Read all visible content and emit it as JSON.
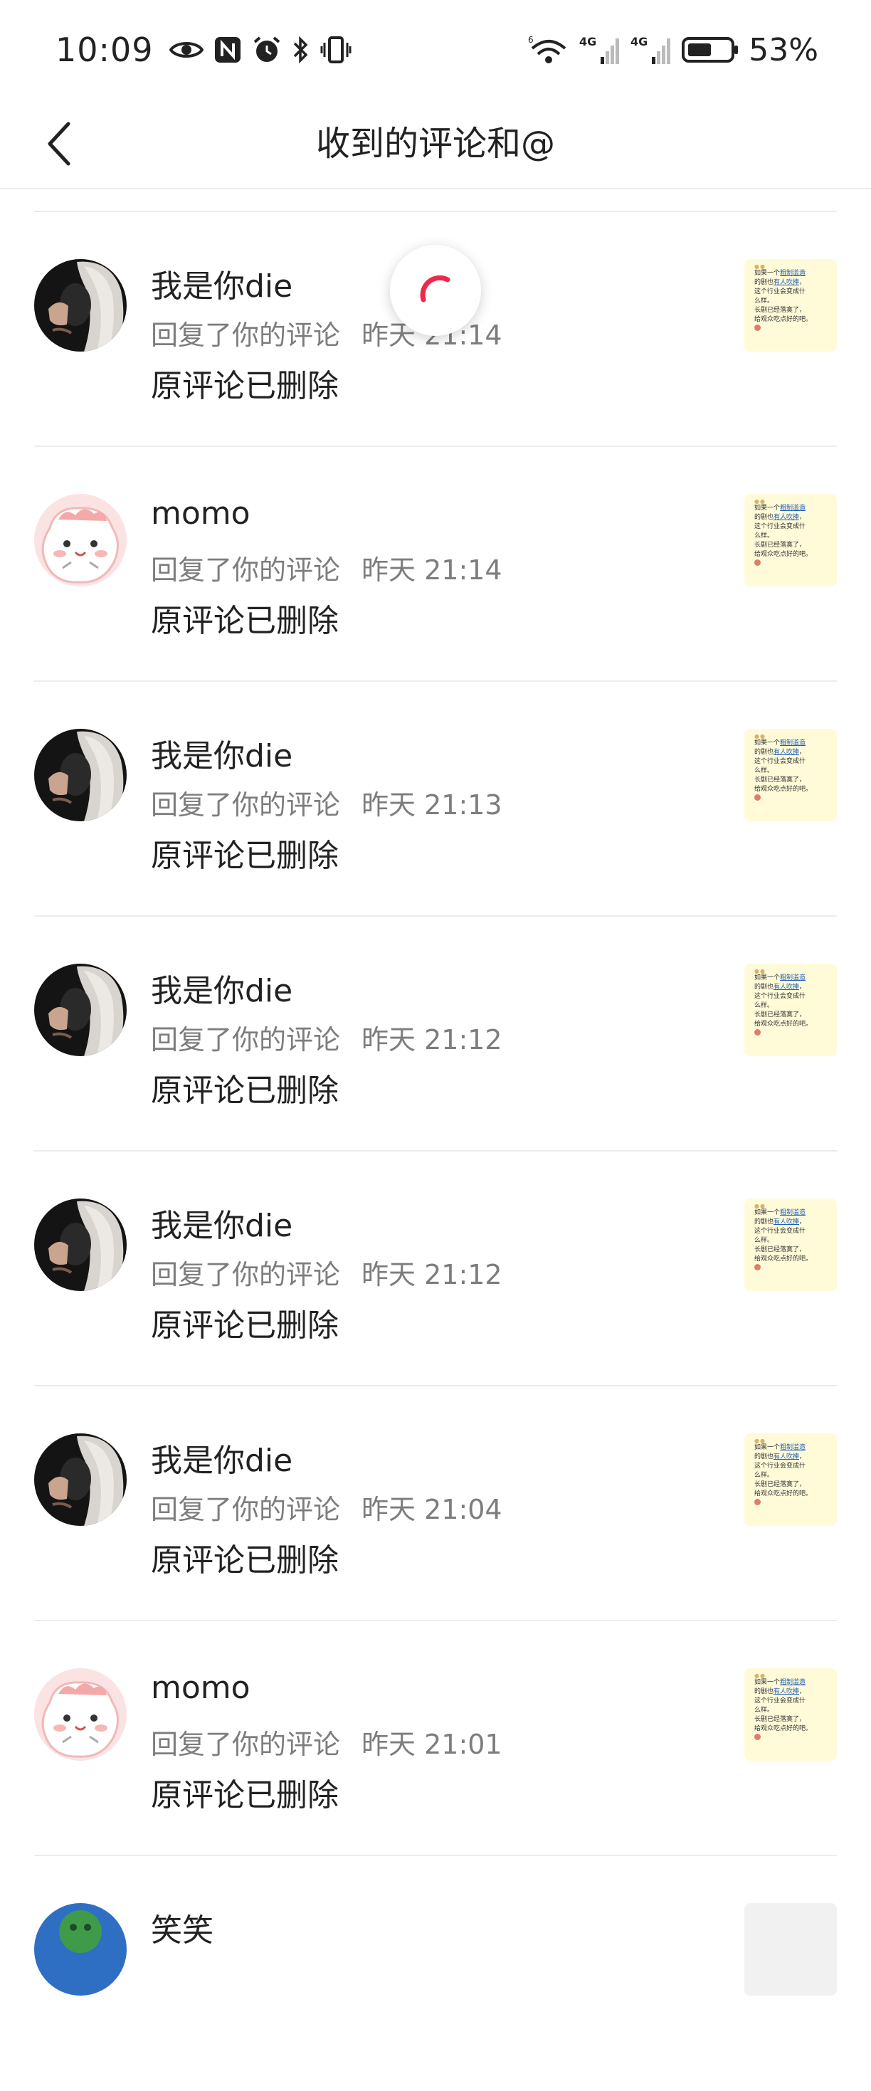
{
  "status_bar": {
    "time": "10:09",
    "battery": "53%",
    "network_1": "4G",
    "network_2": "4G",
    "wifi_badge": "6"
  },
  "header": {
    "title": "收到的评论和@"
  },
  "items": [
    {
      "name": "我是你die",
      "action": "回复了你的评论",
      "time": "昨天 21:14",
      "content": "原评论已删除",
      "avatar": "dark"
    },
    {
      "name": "momo",
      "action": "回复了你的评论",
      "time": "昨天 21:14",
      "content": "原评论已删除",
      "avatar": "pink"
    },
    {
      "name": "我是你die",
      "action": "回复了你的评论",
      "time": "昨天 21:13",
      "content": "原评论已删除",
      "avatar": "dark"
    },
    {
      "name": "我是你die",
      "action": "回复了你的评论",
      "time": "昨天 21:12",
      "content": "原评论已删除",
      "avatar": "dark"
    },
    {
      "name": "我是你die",
      "action": "回复了你的评论",
      "time": "昨天 21:12",
      "content": "原评论已删除",
      "avatar": "dark"
    },
    {
      "name": "我是你die",
      "action": "回复了你的评论",
      "time": "昨天 21:04",
      "content": "原评论已删除",
      "avatar": "dark"
    },
    {
      "name": "momo",
      "action": "回复了你的评论",
      "time": "昨天 21:01",
      "content": "原评论已删除",
      "avatar": "pink"
    },
    {
      "name": "笑笑",
      "avatar": "green"
    }
  ],
  "thumbnail": {
    "lines": [
      "如果一个",
      "粗制滥造",
      "的剧也",
      "有人吹捧",
      "，",
      "这个行业会变成什",
      "么样。",
      "长剧已经落寞了，",
      "给观众吃点好的吧。"
    ]
  },
  "colors": {
    "accent": "#f0284a",
    "thumb_bg": "#fffbd9",
    "secondary_text": "#7d7d7d",
    "divider": "#ececec"
  }
}
